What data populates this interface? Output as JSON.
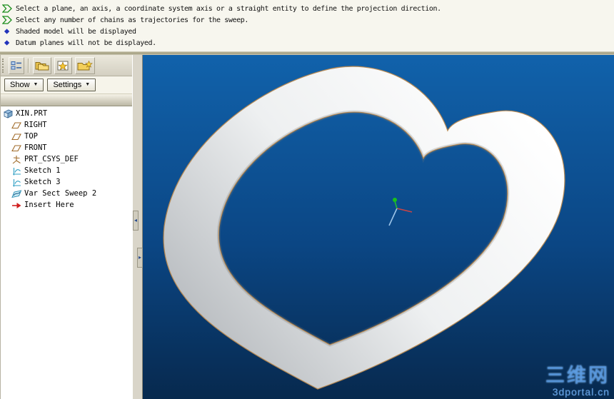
{
  "message_area": {
    "lines": [
      {
        "icon": "prompt-arrow-icon",
        "text": "Select a plane, an axis, a coordinate system axis or a straight entity to define the projection direction."
      },
      {
        "icon": "prompt-arrow-icon",
        "text": "Select any number of chains as trajectories for the sweep."
      },
      {
        "icon": "info-bullet-icon",
        "text": "Shaded model will be displayed"
      },
      {
        "icon": "info-bullet-icon",
        "text": "Datum planes will not be displayed."
      }
    ]
  },
  "tree_panel": {
    "toolbar": {
      "icons": [
        "model-tree-grid-icon",
        "paste-folders-icon",
        "favorites-star-icon",
        "folder-star-icon"
      ]
    },
    "menubar": {
      "show_label": "Show",
      "settings_label": "Settings",
      "dropdown_glyph": "▼"
    },
    "tree": {
      "items": [
        {
          "label": "XIN.PRT",
          "icon": "part-icon",
          "level": 0
        },
        {
          "label": "RIGHT",
          "icon": "datum-plane-icon",
          "level": 1
        },
        {
          "label": "TOP",
          "icon": "datum-plane-icon",
          "level": 1
        },
        {
          "label": "FRONT",
          "icon": "datum-plane-icon",
          "level": 1
        },
        {
          "label": "PRT_CSYS_DEF",
          "icon": "csys-icon",
          "level": 1
        },
        {
          "label": "Sketch 1",
          "icon": "sketch-icon",
          "level": 1
        },
        {
          "label": "Sketch 3",
          "icon": "sketch-icon",
          "level": 1
        },
        {
          "label": "Var Sect Sweep 2",
          "icon": "sweep-icon",
          "level": 1
        },
        {
          "label": "Insert Here",
          "icon": "insert-here-icon",
          "level": 1
        }
      ]
    }
  },
  "splitter": {
    "collapse_left_glyph": "◂",
    "collapse_right_glyph": "▸"
  },
  "viewport": {
    "model": "heart-shaped sweep ring",
    "watermark": {
      "title": "三维网",
      "subtitle": "3dportal.cn"
    }
  },
  "colors": {
    "viewport_top": "#1162ab",
    "viewport_bottom": "#07294e",
    "model_edge_highlight": "#b8864b",
    "prompt_green": "#1a8c1a",
    "info_blue": "#2233bb",
    "watermark_blue": "#4a90e0"
  }
}
